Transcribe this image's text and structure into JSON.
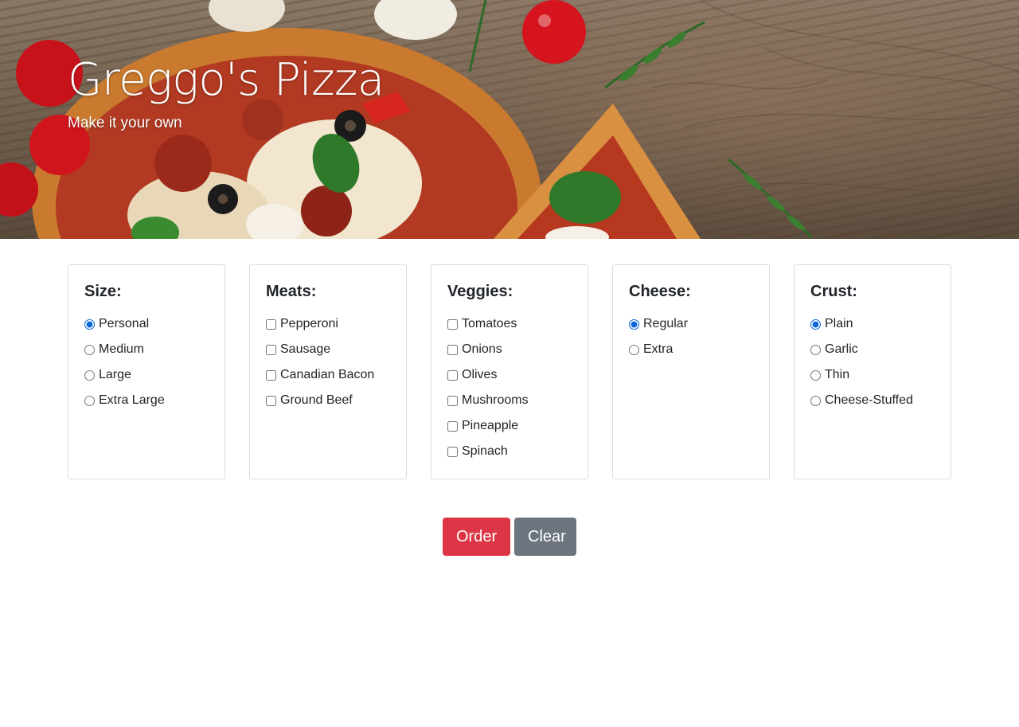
{
  "hero": {
    "title": "Greggo's Pizza",
    "subtitle": "Make it your own"
  },
  "colors": {
    "order_button": "#dc3545",
    "clear_button": "#6c757d",
    "accent": "#0a66d9"
  },
  "cards": {
    "size": {
      "title": "Size:",
      "input_type": "radio",
      "options": [
        {
          "label": "Personal",
          "checked": true
        },
        {
          "label": "Medium",
          "checked": false
        },
        {
          "label": "Large",
          "checked": false
        },
        {
          "label": "Extra Large",
          "checked": false
        }
      ]
    },
    "meats": {
      "title": "Meats:",
      "input_type": "checkbox",
      "options": [
        {
          "label": "Pepperoni",
          "checked": false
        },
        {
          "label": "Sausage",
          "checked": false
        },
        {
          "label": "Canadian Bacon",
          "checked": false
        },
        {
          "label": "Ground Beef",
          "checked": false
        }
      ]
    },
    "veggies": {
      "title": "Veggies:",
      "input_type": "checkbox",
      "options": [
        {
          "label": "Tomatoes",
          "checked": false
        },
        {
          "label": "Onions",
          "checked": false
        },
        {
          "label": "Olives",
          "checked": false
        },
        {
          "label": "Mushrooms",
          "checked": false
        },
        {
          "label": "Pineapple",
          "checked": false
        },
        {
          "label": "Spinach",
          "checked": false
        }
      ]
    },
    "cheese": {
      "title": "Cheese:",
      "input_type": "radio",
      "options": [
        {
          "label": "Regular",
          "checked": true
        },
        {
          "label": "Extra",
          "checked": false
        }
      ]
    },
    "crust": {
      "title": "Crust:",
      "input_type": "radio",
      "options": [
        {
          "label": "Plain",
          "checked": true
        },
        {
          "label": "Garlic",
          "checked": false
        },
        {
          "label": "Thin",
          "checked": false
        },
        {
          "label": "Cheese-Stuffed",
          "checked": false
        }
      ]
    }
  },
  "actions": {
    "order_label": "Order",
    "clear_label": "Clear"
  }
}
